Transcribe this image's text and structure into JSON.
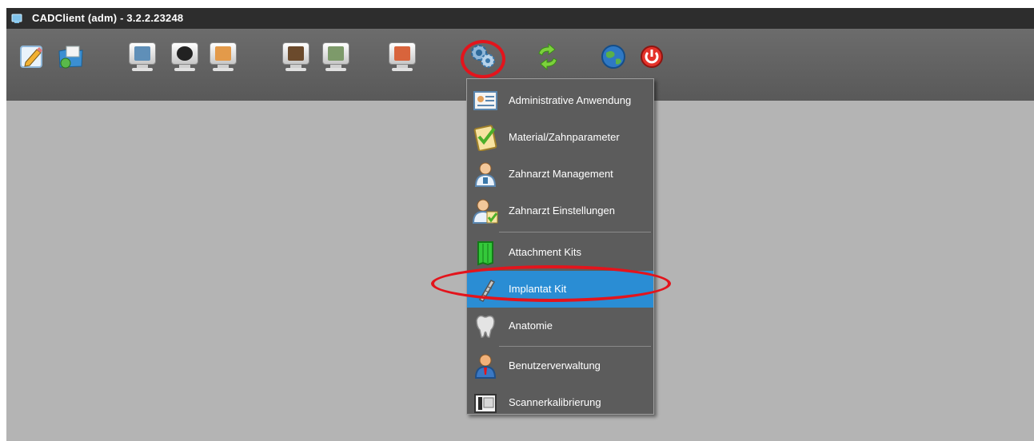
{
  "window": {
    "title": "CADClient (adm) - 3.2.2.23248"
  },
  "toolbar": {
    "buttons": [
      {
        "name": "edit-icon"
      },
      {
        "name": "open-folder-icon"
      },
      {
        "name": "monitor-icon"
      },
      {
        "name": "monitor-icon"
      },
      {
        "name": "monitor-icon"
      },
      {
        "name": "monitor-icon"
      },
      {
        "name": "monitor-icon"
      },
      {
        "name": "monitor-icon"
      },
      {
        "name": "gear-icon"
      },
      {
        "name": "sync-icon"
      },
      {
        "name": "globe-icon"
      },
      {
        "name": "power-icon"
      }
    ]
  },
  "menu": {
    "items": [
      {
        "label": "Administrative Anwendung",
        "icon": "card-icon"
      },
      {
        "label": "Material/Zahnparameter",
        "icon": "clipboard-icon"
      },
      {
        "label": "Zahnarzt Management",
        "icon": "dentist-icon"
      },
      {
        "label": "Zahnarzt Einstellungen",
        "icon": "dentist-settings-icon"
      },
      {
        "label": "Attachment Kits",
        "icon": "attachment-icon"
      },
      {
        "label": "Implantat Kit",
        "icon": "implant-icon",
        "selected": true
      },
      {
        "label": "Anatomie",
        "icon": "tooth-icon"
      },
      {
        "label": "Benutzerverwaltung",
        "icon": "user-icon"
      },
      {
        "label": "Scannerkalibrierung",
        "icon": "scanner-icon"
      }
    ]
  },
  "colors": {
    "menu_bg": "#5c5c5c",
    "selection": "#2a8dd4",
    "annotation": "#e3141c",
    "workspace": "#b4b4b4"
  }
}
